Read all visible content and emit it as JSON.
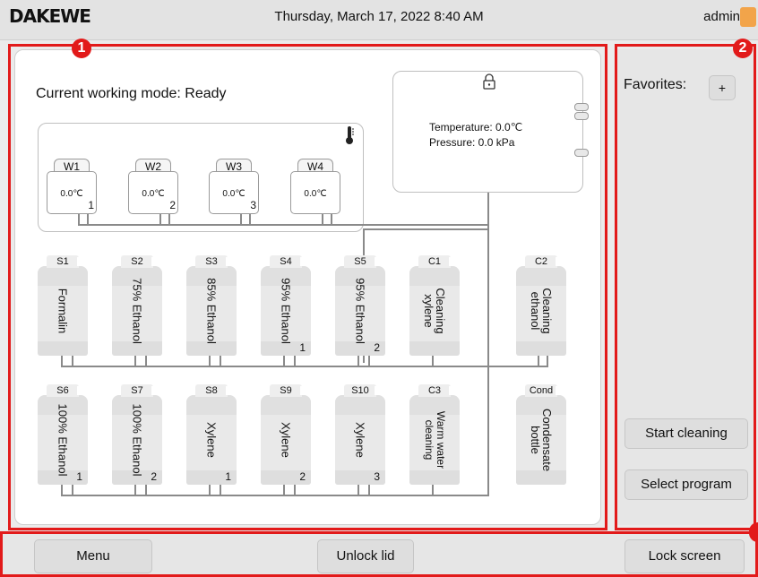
{
  "header": {
    "logo": "DAKEWE",
    "datetime": "Thursday, March 17, 2022  8:40 AM",
    "user": "admin"
  },
  "callouts": {
    "b1": "1",
    "b2": "2"
  },
  "status": {
    "mode_label": "Current working mode:",
    "mode_value": "Ready"
  },
  "water_stations": [
    {
      "label": "W1",
      "temp": "0.0℃",
      "num": "1"
    },
    {
      "label": "W2",
      "temp": "0.0℃",
      "num": "2"
    },
    {
      "label": "W3",
      "temp": "0.0℃",
      "num": "3"
    },
    {
      "label": "W4",
      "temp": "0.0℃",
      "num": ""
    }
  ],
  "lid": {
    "temperature": "Temperature:  0.0℃",
    "pressure": "Pressure:  0.0 kPa"
  },
  "bottles_row1": [
    {
      "cap": "S1",
      "label": "Formalin",
      "num": ""
    },
    {
      "cap": "S2",
      "label": "75% Ethanol",
      "num": ""
    },
    {
      "cap": "S3",
      "label": "85% Ethanol",
      "num": ""
    },
    {
      "cap": "S4",
      "label": "95% Ethanol",
      "num": "1"
    },
    {
      "cap": "S5",
      "label": "95% Ethanol",
      "num": "2"
    },
    {
      "cap": "C1",
      "label": "Cleaning xylene",
      "num": ""
    },
    {
      "cap": "C2",
      "label": "Cleaning ethanol",
      "num": ""
    }
  ],
  "bottles_row2": [
    {
      "cap": "S6",
      "label": "100% Ethanol",
      "num": "1"
    },
    {
      "cap": "S7",
      "label": "100% Ethanol",
      "num": "2"
    },
    {
      "cap": "S8",
      "label": "Xylene",
      "num": "1"
    },
    {
      "cap": "S9",
      "label": "Xylene",
      "num": "2"
    },
    {
      "cap": "S10",
      "label": "Xylene",
      "num": "3"
    },
    {
      "cap": "C3",
      "label": "Warm water cleaning",
      "num": ""
    },
    {
      "cap": "Cond",
      "label": "Condensate bottle",
      "num": ""
    }
  ],
  "sidebar": {
    "favorites_label": "Favorites:",
    "add_label": "+",
    "start_cleaning": "Start cleaning",
    "select_program": "Select program"
  },
  "footer": {
    "menu": "Menu",
    "unlock_lid": "Unlock lid",
    "lock_screen": "Lock screen"
  }
}
